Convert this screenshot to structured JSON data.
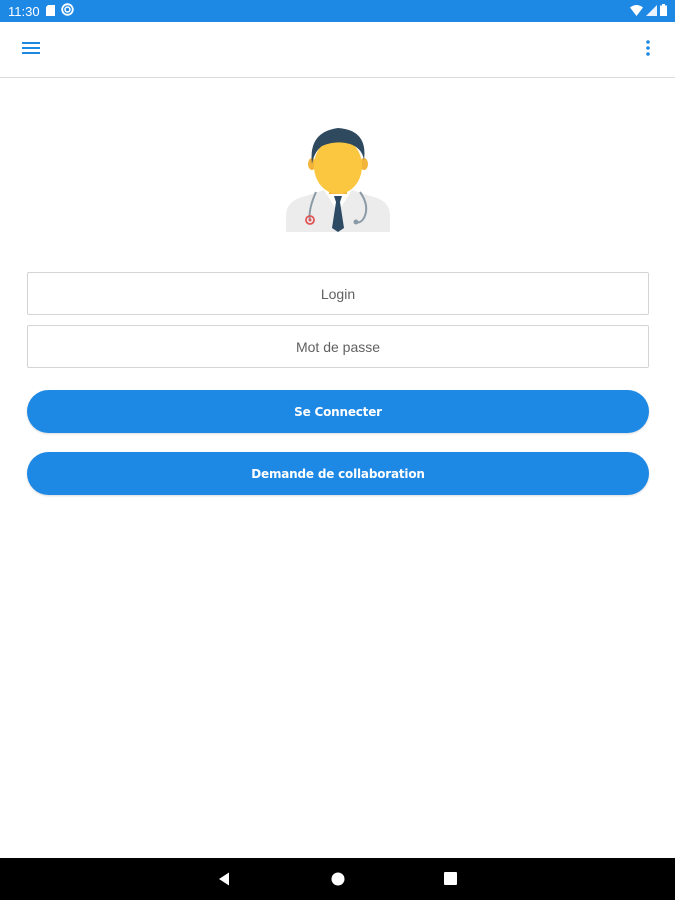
{
  "status_bar": {
    "time": "11:30",
    "icons": [
      "sd-card-icon",
      "sync-icon",
      "wifi-icon",
      "signal-icon",
      "battery-icon"
    ]
  },
  "toolbar": {
    "menu_icon": "hamburger-menu-icon",
    "overflow_icon": "more-vert-icon"
  },
  "avatar": {
    "icon": "doctor-avatar"
  },
  "form": {
    "login_placeholder": "Login",
    "password_placeholder": "Mot de passe",
    "login_value": "",
    "password_value": ""
  },
  "buttons": {
    "connect_label": "Se Connecter",
    "collaboration_label": "Demande de collaboration"
  },
  "nav_bar": {
    "icons": [
      "back-icon",
      "home-icon",
      "recents-icon"
    ]
  },
  "colors": {
    "primary": "#1e88e5",
    "background": "#ffffff",
    "field_border": "#d4d4d4",
    "nav_bar": "#000000"
  }
}
